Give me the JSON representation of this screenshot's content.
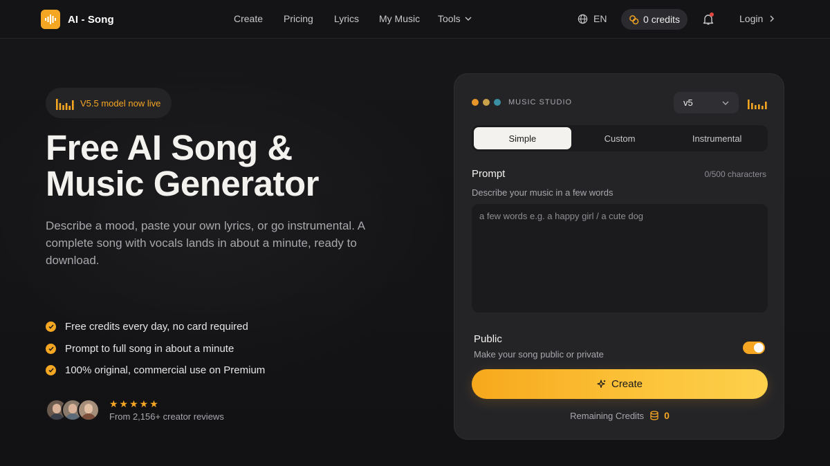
{
  "brand": {
    "name": "AI - Song",
    "accent": "#f5a623"
  },
  "nav": {
    "items": [
      "Create",
      "Pricing",
      "Lyrics",
      "My Music"
    ],
    "tools_label": "Tools"
  },
  "header": {
    "language": "EN",
    "credits": "0 credits",
    "login": "Login"
  },
  "hero": {
    "badge": "V5.5 model now live",
    "title_line1": "Free AI Song &",
    "title_line2": "Music Generator",
    "description": "Describe a mood, paste your own lyrics, or go instrumental. A complete song with vocals lands in about a minute, ready to download.",
    "features": [
      "Free credits every day, no card required",
      "Prompt to full song in about a minute",
      "100% original, commercial use on Premium"
    ],
    "rating_stars": 5,
    "reviews_text": "From 2,156+ creator reviews"
  },
  "studio": {
    "label": "MUSIC STUDIO",
    "model": "v5",
    "tabs": [
      "Simple",
      "Custom",
      "Instrumental"
    ],
    "active_tab": "Simple",
    "prompt_label": "Prompt",
    "char_count": "0/500 characters",
    "prompt_help": "Describe your music in a few words",
    "prompt_placeholder": "a few words e.g. a happy girl / a cute dog",
    "prompt_value": "",
    "public_label": "Public",
    "public_help": "Make your song public or private",
    "public_enabled": true,
    "create_label": "Create",
    "remaining_label": "Remaining Credits",
    "remaining_value": "0"
  }
}
